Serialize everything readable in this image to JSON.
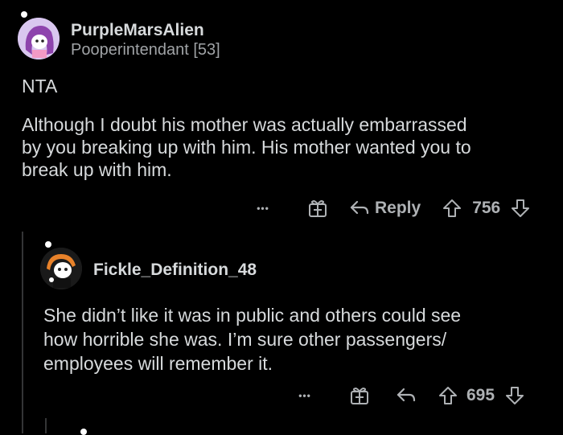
{
  "comment1": {
    "username": "PurpleMarsAlien",
    "flair": "Pooperintendant [53]",
    "body_line0": "NTA",
    "body_lines": [
      "Although I doubt his mother was actually embarrassed",
      "by you breaking up with him. His mother wanted you to",
      "break up with him."
    ],
    "more": "•••",
    "reply_label": "Reply",
    "score": "756"
  },
  "comment2": {
    "username": "Fickle_Definition_48",
    "body_lines": [
      "She didn’t like it was in public and others could see",
      "how horrible she was. I’m sure other passengers/",
      "employees will remember it."
    ],
    "more": "•••",
    "score": "695"
  },
  "icons": {
    "more": "more-options-icon",
    "award": "gift-award-icon",
    "reply": "reply-arrow-icon",
    "upvote": "upvote-arrow-icon",
    "downvote": "downvote-arrow-icon"
  },
  "colors": {
    "background": "#000000",
    "text": "#d7dadc",
    "muted": "#8a8d91",
    "avatar_purple": "#9b59b6"
  }
}
